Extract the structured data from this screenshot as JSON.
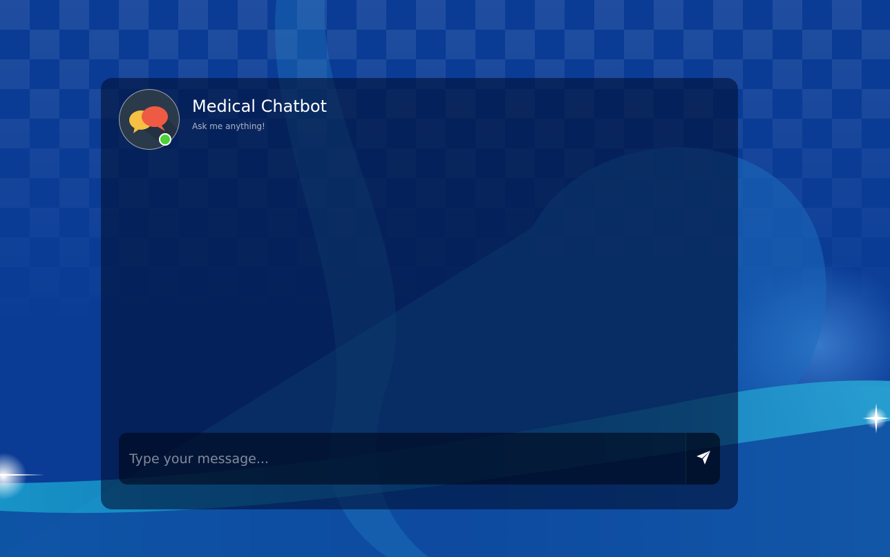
{
  "colors": {
    "background": "#073a93",
    "card": "rgba(0,14,48,0.58)",
    "online_status": "#4cd137",
    "title": "#ffffff"
  },
  "header": {
    "avatar_icon": "speech-bubbles-icon",
    "title": "Medical Chatbot",
    "subtitle": "Ask me anything!",
    "status": "online"
  },
  "input": {
    "value": "",
    "placeholder": "Type your message...",
    "send_icon": "paper-plane-icon"
  }
}
